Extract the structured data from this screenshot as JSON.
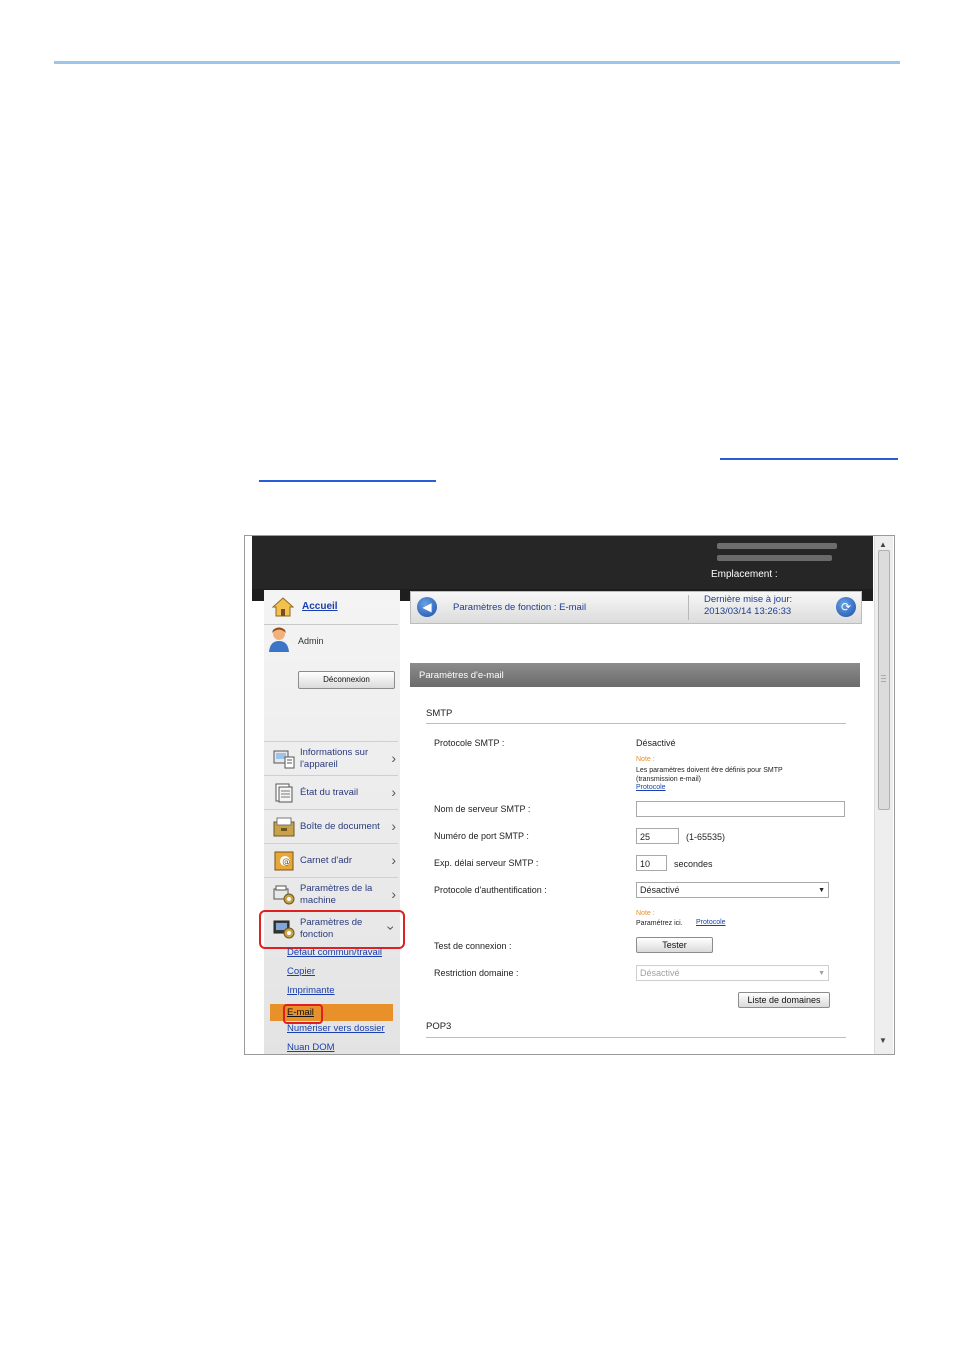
{
  "device": {
    "location_label": "Emplacement :"
  },
  "sidebar": {
    "home_label": "Accueil",
    "user_label": "Admin",
    "logout_label": "Déconnexion",
    "nav_items": [
      {
        "label_line1": "Informations sur",
        "label_line2": "l'appareil",
        "icon": "device-info-icon"
      },
      {
        "label_line1": "État du travail",
        "label_line2": "",
        "icon": "job-status-icon"
      },
      {
        "label_line1": "Boîte de document",
        "label_line2": "",
        "icon": "document-box-icon"
      },
      {
        "label_line1": "Carnet d'adr",
        "label_line2": "",
        "icon": "address-book-icon"
      },
      {
        "label_line1": "Paramètres de la",
        "label_line2": "machine",
        "icon": "machine-settings-icon"
      },
      {
        "label_line1": "Paramètres de",
        "label_line2": "fonction",
        "icon": "function-settings-icon"
      }
    ],
    "sub_items": [
      "Défaut commun/travail",
      "Copier",
      "Imprimante",
      "E-mail",
      "Numériser vers dossier",
      "Nuan DOM"
    ],
    "active_sub": "E-mail"
  },
  "header": {
    "breadcrumb": "Paramètres de fonction : E-mail",
    "last_update_label": "Dernière mise à jour:",
    "last_update_value": "2013/03/14 13:26:33"
  },
  "panel": {
    "title": "Paramètres d'e-mail",
    "smtp_section": "SMTP",
    "smtp_protocol_label": "Protocole SMTP :",
    "smtp_protocol_value": "Désactivé",
    "note_label": "Note :",
    "smtp_note_line1": "Les paramètres doivent être définis pour SMTP",
    "smtp_note_line2": "(transmission e-mail)",
    "smtp_note_link": "Protocole",
    "server_name_label": "Nom de serveur SMTP :",
    "server_name_value": "",
    "port_label": "Numéro de port SMTP :",
    "port_value": "25",
    "port_range": "(1-65535)",
    "timeout_label": "Exp. délai serveur SMTP :",
    "timeout_value": "10",
    "timeout_unit": "secondes",
    "auth_label": "Protocole d'authentification :",
    "auth_value": "Désactivé",
    "auth_note_text": "Paramétrez ici.",
    "auth_note_link": "Protocole",
    "test_label": "Test de connexion :",
    "test_button": "Tester",
    "domain_label": "Restriction domaine :",
    "domain_value": "Désactivé",
    "domain_list_button": "Liste de domaines",
    "pop3_section": "POP3"
  },
  "colors": {
    "active_orange": "#e8902a",
    "highlight_red": "#e02020",
    "link_blue": "#1a3fae"
  }
}
